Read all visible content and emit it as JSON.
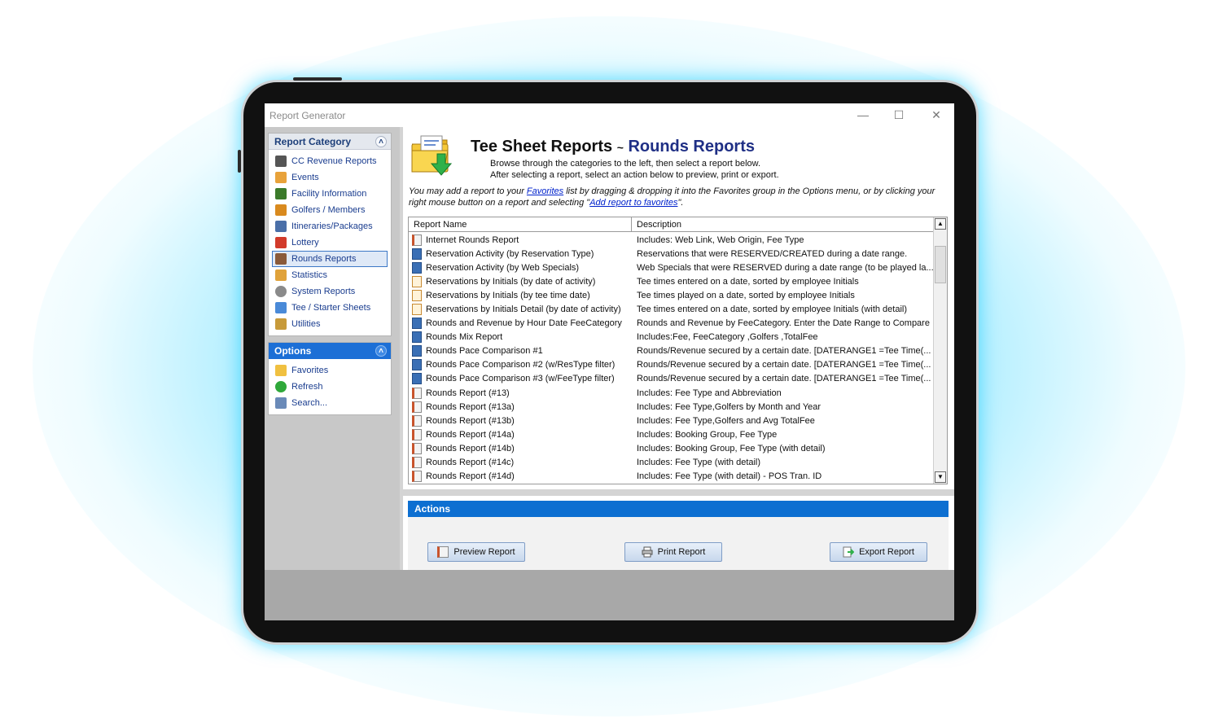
{
  "window": {
    "title": "Report Generator"
  },
  "report_category": {
    "title": "Report Category",
    "items": [
      {
        "label": "CC Revenue Reports",
        "icon": "credit-card-icon"
      },
      {
        "label": "Events",
        "icon": "calendar-icon"
      },
      {
        "label": "Facility Information",
        "icon": "golf-cart-icon"
      },
      {
        "label": "Golfers / Members",
        "icon": "people-icon"
      },
      {
        "label": "Itineraries/Packages",
        "icon": "package-icon"
      },
      {
        "label": "Lottery",
        "icon": "calendar-red-icon"
      },
      {
        "label": "Rounds Reports",
        "icon": "report-icon",
        "selected": true
      },
      {
        "label": "Statistics",
        "icon": "stats-icon"
      },
      {
        "label": "System Reports",
        "icon": "gear-icon"
      },
      {
        "label": "Tee / Starter Sheets",
        "icon": "sheet-icon"
      },
      {
        "label": "Utilities",
        "icon": "wrench-icon"
      }
    ]
  },
  "options": {
    "title": "Options",
    "items": [
      {
        "label": "Favorites",
        "icon": "favorites-folder-icon"
      },
      {
        "label": "Refresh",
        "icon": "refresh-icon"
      },
      {
        "label": "Search...",
        "icon": "search-icon"
      }
    ]
  },
  "header": {
    "title": "Tee Sheet Reports",
    "separator": "~",
    "subtitle": "Rounds Reports",
    "line1": "Browse through the categories to the left, then select a report below.",
    "line2": "After selecting a report, select an action below to preview, print or export.",
    "fav_note_part1": "You may add a report to your ",
    "fav_link": "Favorites",
    "fav_note_part2": " list by dragging & dropping it into the Favorites group in the Options menu, or by clicking your right mouse button on a report and selecting \"",
    "add_link": "Add report to favorites",
    "fav_note_part3": "\"."
  },
  "grid": {
    "columns": [
      "Report Name",
      "Description"
    ],
    "rows": [
      {
        "name": "Internet Rounds Report",
        "desc": "Includes: Web Link, Web Origin, Fee Type",
        "icon": "doc"
      },
      {
        "name": "Reservation Activity (by Reservation Type)",
        "desc": "Reservations that were RESERVED/CREATED during a date range.",
        "icon": "blue"
      },
      {
        "name": "Reservation Activity (by Web Specials)",
        "desc": "Web Specials that were RESERVED during a date range (to be played la...",
        "icon": "blue"
      },
      {
        "name": "Reservations by Initials (by date of activity)",
        "desc": "Tee times entered on a date, sorted by employee Initials",
        "icon": "cal"
      },
      {
        "name": "Reservations by Initials (by tee time date)",
        "desc": "Tee times played on a date, sorted by employee Initials",
        "icon": "cal"
      },
      {
        "name": "Reservations by Initials Detail (by date of activity)",
        "desc": "Tee times entered on a date, sorted by employee Initials (with detail)",
        "icon": "cal"
      },
      {
        "name": "Rounds and Revenue by Hour Date FeeCategory",
        "desc": "Rounds and Revenue by FeeCategory. Enter the Date Range to Compare",
        "icon": "blue"
      },
      {
        "name": "Rounds Mix Report",
        "desc": "Includes:Fee, FeeCategory ,Golfers ,TotalFee",
        "icon": "blue"
      },
      {
        "name": "Rounds Pace Comparison #1",
        "desc": "Rounds/Revenue secured by a certain date.  [DATERANGE1 =Tee Time(...",
        "icon": "blue"
      },
      {
        "name": "Rounds Pace Comparison #2 (w/ResType filter)",
        "desc": "Rounds/Revenue secured by a certain date.  [DATERANGE1 =Tee Time(...",
        "icon": "blue"
      },
      {
        "name": "Rounds Pace Comparison #3 (w/FeeType filter)",
        "desc": "Rounds/Revenue secured by a certain date.  [DATERANGE1 =Tee Time(...",
        "icon": "blue"
      },
      {
        "name": "Rounds Report  (#13)",
        "desc": "Includes: Fee Type and Abbreviation",
        "icon": "doc"
      },
      {
        "name": "Rounds Report  (#13a)",
        "desc": "Includes: Fee Type,Golfers by Month and Year",
        "icon": "doc"
      },
      {
        "name": "Rounds Report  (#13b)",
        "desc": "Includes: Fee Type,Golfers and Avg TotalFee",
        "icon": "doc"
      },
      {
        "name": "Rounds Report  (#14a)",
        "desc": "Includes: Booking Group, Fee Type",
        "icon": "doc"
      },
      {
        "name": "Rounds Report  (#14b)",
        "desc": "Includes: Booking Group, Fee Type (with detail)",
        "icon": "doc"
      },
      {
        "name": "Rounds Report  (#14c)",
        "desc": "Includes:  Fee Type (with detail)",
        "icon": "doc"
      },
      {
        "name": "Rounds Report  (#14d)",
        "desc": "Includes:  Fee Type (with detail) - POS Tran. ID",
        "icon": "doc"
      }
    ]
  },
  "actions": {
    "title": "Actions",
    "preview": "Preview Report",
    "print": "Print Report",
    "export": "Export Report"
  },
  "colors": {
    "accent": "#0d6fd1",
    "nav_text": "#1a3d8f",
    "subtitle": "#1f2f85",
    "glow": "#00d2ff"
  }
}
